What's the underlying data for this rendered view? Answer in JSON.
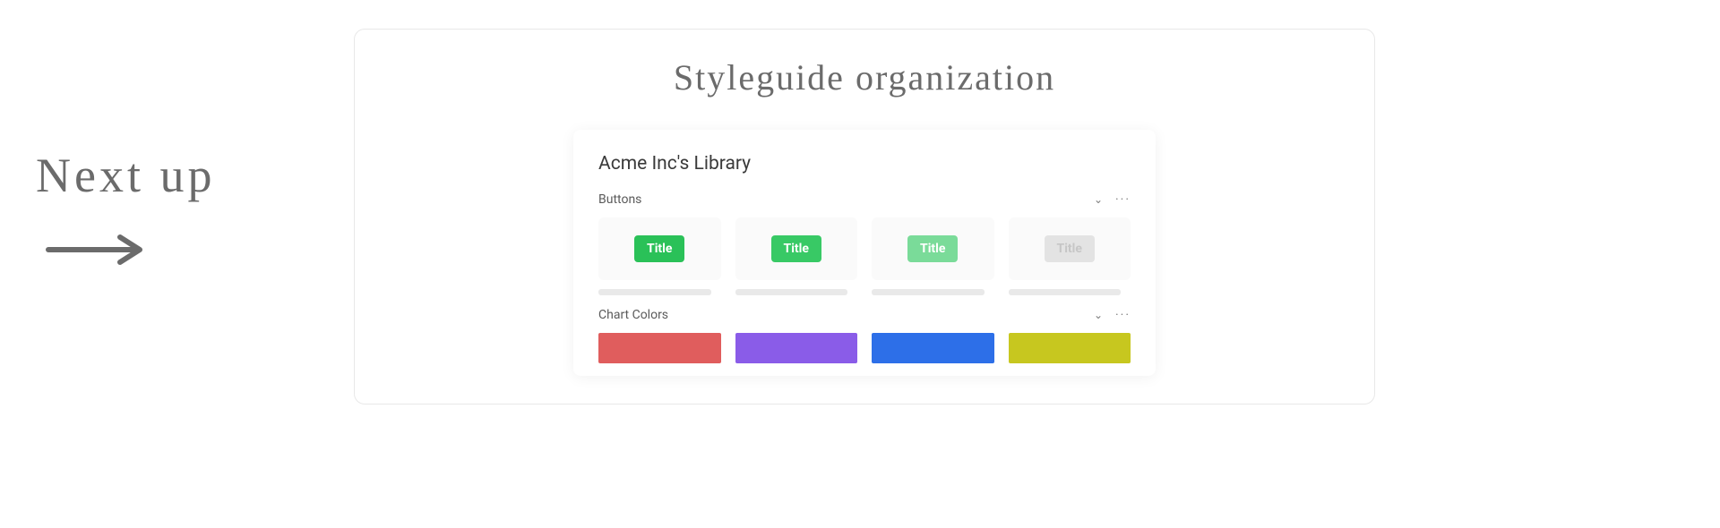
{
  "annotation": {
    "next_up": "Next up"
  },
  "card": {
    "title": "Styleguide organization"
  },
  "library": {
    "title": "Acme Inc's Library",
    "sections": [
      {
        "name": "Buttons",
        "items": [
          {
            "label": "Title",
            "variant": "primary",
            "color": "#2ac158"
          },
          {
            "label": "Title",
            "variant": "primary-hover",
            "color": "#38c965"
          },
          {
            "label": "Title",
            "variant": "light",
            "color": "#7adb99"
          },
          {
            "label": "Title",
            "variant": "disabled",
            "color": "#e3e3e3"
          }
        ]
      },
      {
        "name": "Chart Colors",
        "swatches": [
          {
            "color": "#e05d5d"
          },
          {
            "color": "#8a5ce8"
          },
          {
            "color": "#2d6fe8"
          },
          {
            "color": "#c7c71f"
          }
        ]
      }
    ]
  }
}
